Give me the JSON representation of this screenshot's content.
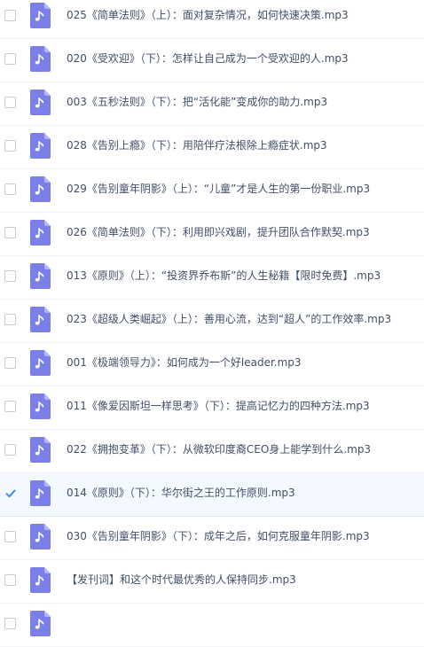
{
  "files": [
    {
      "name": "025《简单法则》（上）：面对复杂情况，如何快速决策.mp3",
      "checked": false
    },
    {
      "name": "020《受欢迎》（下）：怎样让自己成为一个受欢迎的人.mp3",
      "checked": false
    },
    {
      "name": "003《五秒法则》（下）：把“活化能”变成你的助力.mp3",
      "checked": false
    },
    {
      "name": "028《告别上瘾》（下）：用陪伴疗法根除上瘾症状.mp3",
      "checked": false
    },
    {
      "name": "029《告别童年阴影》（上）：“儿童”才是人生的第一份职业.mp3",
      "checked": false
    },
    {
      "name": "026《简单法则》（下）：利用即兴戏剧，提升团队合作默契.mp3",
      "checked": false
    },
    {
      "name": "013《原则》（上）：“投资界乔布斯”的人生秘籍【限时免费】.mp3",
      "checked": false
    },
    {
      "name": "023《超级人类崛起》（上）：善用心流，达到“超人”的工作效率.mp3",
      "checked": false
    },
    {
      "name": "001《极端领导力》：如何成为一个好leader.mp3",
      "checked": false
    },
    {
      "name": "011《像爱因斯坦一样思考》（下）：提高记忆力的四种方法.mp3",
      "checked": false
    },
    {
      "name": "022《拥抱变革》（下）：从微软印度裔CEO身上能学到什么.mp3",
      "checked": false
    },
    {
      "name": "014《原则》（下）：华尔街之王的工作原则.mp3",
      "checked": true
    },
    {
      "name": "030《告别童年阴影》（下）：成年之后，如何克服童年阴影.mp3",
      "checked": false
    },
    {
      "name": "【发刊词】和这个时代最优秀的人保持同步.mp3",
      "checked": false
    },
    {
      "name": "",
      "checked": false
    }
  ],
  "icon": "music-file-icon",
  "colors": {
    "icon_bg": "#7b7fe8",
    "icon_fold": "#b3b6f3",
    "check_blue": "#3b8cf0",
    "text": "#424e67",
    "selected_row": "#f4f9ff"
  }
}
